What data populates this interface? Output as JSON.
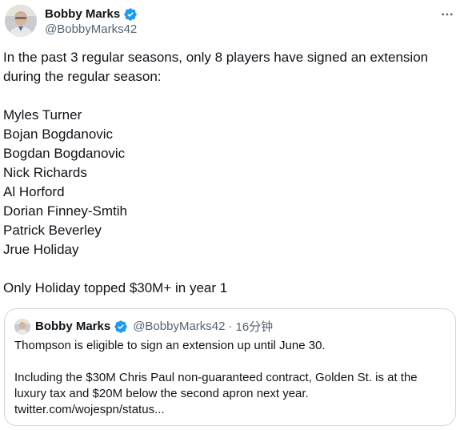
{
  "tweet": {
    "author": {
      "display_name": "Bobby Marks",
      "handle": "@BobbyMarks42",
      "avatar_icon": "user-avatar-photo",
      "verified_icon": "verified-badge-icon"
    },
    "more_icon": "more-options-icon",
    "lines": [
      "In the past 3 regular seasons, only 8 players have signed an extension",
      "during the regular season:",
      "",
      "Myles Turner",
      "Bojan Bogdanovic",
      "Bogdan Bogdanovic",
      "Nick Richards",
      "Al Horford",
      "Dorian Finney-Smtih",
      "Patrick Beverley",
      "Jrue Holiday",
      "",
      "Only Holiday topped $30M+ in year 1"
    ]
  },
  "quoted_tweet": {
    "author": {
      "display_name": "Bobby Marks",
      "handle": "@BobbyMarks42",
      "avatar_icon": "user-avatar-photo",
      "verified_icon": "verified-badge-icon"
    },
    "separator": "·",
    "time": "16分钟",
    "lines": [
      "Thompson is eligible to sign an extension up until June 30.",
      "",
      "Including the $30M Chris Paul non-guaranteed contract, Golden St. is at the",
      "luxury tax and $20M below the second apron next year.",
      "twitter.com/wojespn/status..."
    ]
  },
  "colors": {
    "text": "#0f1419",
    "secondary": "#536471",
    "verified": "#1d9bf0",
    "border": "#cfd9de"
  }
}
